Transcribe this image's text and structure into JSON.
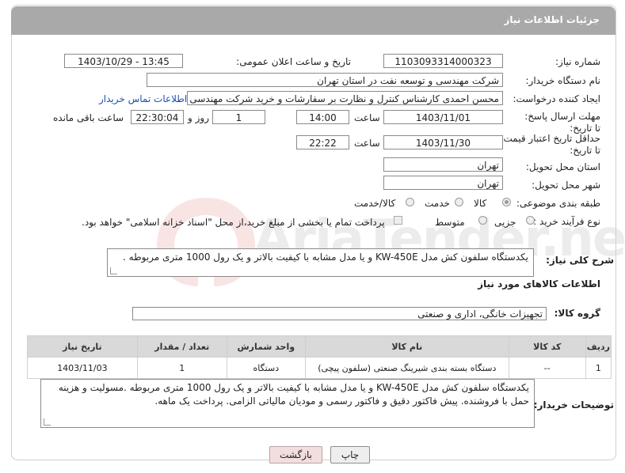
{
  "header": {
    "title": "جزئیات اطلاعات نیاز"
  },
  "form": {
    "need_number_label": "شماره نیاز:",
    "need_number": "1103093314000323",
    "announce_label": "تاریخ و ساعت اعلان عمومی:",
    "announce_value": "1403/10/29 - 13:45",
    "buyer_org_label": "نام دستگاه خریدار:",
    "buyer_org": "شرکت مهندسی و توسعه نفت در استان تهران",
    "requester_label": "ایجاد کننده درخواست:",
    "requester": "محسن احمدی کارشناس کنترل و نظارت بر سفارشات و خرید شرکت مهندسی",
    "contact_link": "اطلاعات تماس خریدار",
    "deadline_label": "مهلت ارسال پاسخ: تا تاریخ:",
    "deadline_date": "1403/11/01",
    "time_label": "ساعت",
    "deadline_time": "14:00",
    "days_value": "1",
    "days_label": "روز و",
    "remaining_value": "22:30:04",
    "remaining_label": "ساعت باقی مانده",
    "price_validity_label": "حداقل تاریخ اعتبار قیمت: تا تاریخ:",
    "price_date": "1403/11/30",
    "price_time": "22:22",
    "province_label": "استان محل تحویل:",
    "province": "تهران",
    "city_label": "شهر محل تحویل:",
    "city": "تهران",
    "category_label": "طبقه بندی موضوعی:",
    "category_goods": "کالا",
    "category_service": "خدمت",
    "category_both": "کالا/خدمت",
    "process_label": "نوع فرآیند خرید :",
    "process_partial": "جزیی",
    "process_medium": "متوسط",
    "treasury_note": "پرداخت تمام یا بخشی از مبلغ خرید،از محل \"اسناد خزانه اسلامی\" خواهد بود.",
    "summary_label": "شرح کلی نیاز:",
    "summary": "یکدستگاه سلفون کش مدل KW-450E و یا مدل مشابه با کیفیت بالاتر و یک رول 1000 متری مربوطه ."
  },
  "goods": {
    "section_title": "اطلاعات کالاهای مورد نیاز",
    "group_label": "گروه کالا:",
    "group_value": "تجهیزات خانگی، اداری و صنعتی",
    "columns": [
      "ردیف",
      "کد کالا",
      "نام کالا",
      "واحد شمارش",
      "تعداد / مقدار",
      "تاریخ نیاز"
    ],
    "rows": [
      [
        "1",
        "--",
        "دستگاه بسته بندی شیرینگ صنعتی (سلفون پیچی)",
        "دستگاه",
        "1",
        "1403/11/03"
      ]
    ]
  },
  "buyer_notes": {
    "label": "توضیحات خریدار:",
    "text": "یکدستگاه سلفون کش مدل KW-450E و یا مدل مشابه با کیفیت بالاتر و یک رول 1000 متری مربوطه .مسولیت و هزینه حمل با فروشنده. پیش فاکتور دقیق و فاکتور رسمی و مودیان مالیاتی الزامی. پرداخت یک ماهه."
  },
  "buttons": {
    "print": "چاپ",
    "back": "بازگشت"
  },
  "watermark": "AriaTender.neT",
  "colors": {
    "header_bg": "#a9a9a9",
    "link": "#1c4fb0",
    "back_button": "#f3dede"
  }
}
